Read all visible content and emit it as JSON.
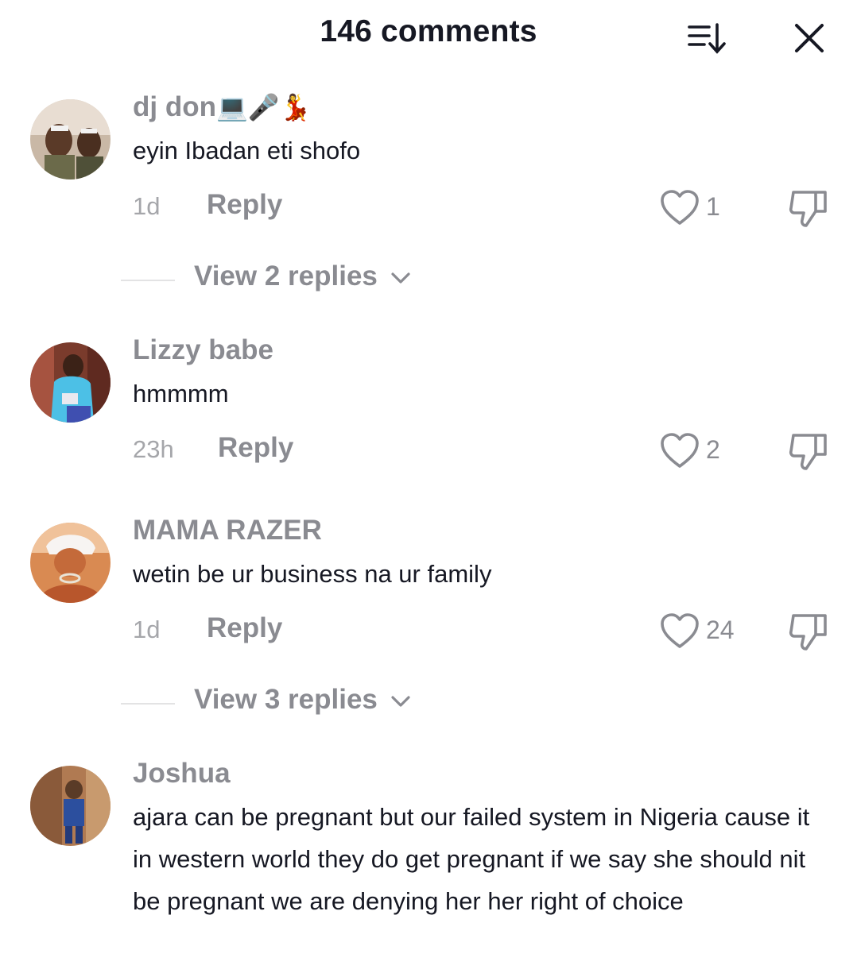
{
  "header": {
    "title": "146 comments",
    "sort_icon": "sort-down-icon",
    "close_icon": "close-icon"
  },
  "comments": [
    {
      "username": "dj don",
      "username_emoji": "💻🎤💃",
      "text": "eyin Ibadan eti shofo",
      "time": "1d",
      "reply_label": "Reply",
      "likes": "1",
      "view_replies": "View 2 replies"
    },
    {
      "username": "Lizzy babe",
      "text": "hmmmm",
      "time": "23h",
      "reply_label": "Reply",
      "likes": "2"
    },
    {
      "username": "MAMA RAZER",
      "text": "wetin be ur business na ur family",
      "time": "1d",
      "reply_label": "Reply",
      "likes": "24",
      "view_replies": "View 3 replies"
    },
    {
      "username": "Joshua",
      "text": "ajara can be pregnant but our failed system in Nigeria cause it in western world they do get pregnant if we say she should nit be pregnant we are denying her her right of choice"
    }
  ],
  "colors": {
    "text_primary": "#161823",
    "text_secondary": "#8a8b91",
    "text_muted": "#a5a6aa",
    "background": "#ffffff"
  }
}
